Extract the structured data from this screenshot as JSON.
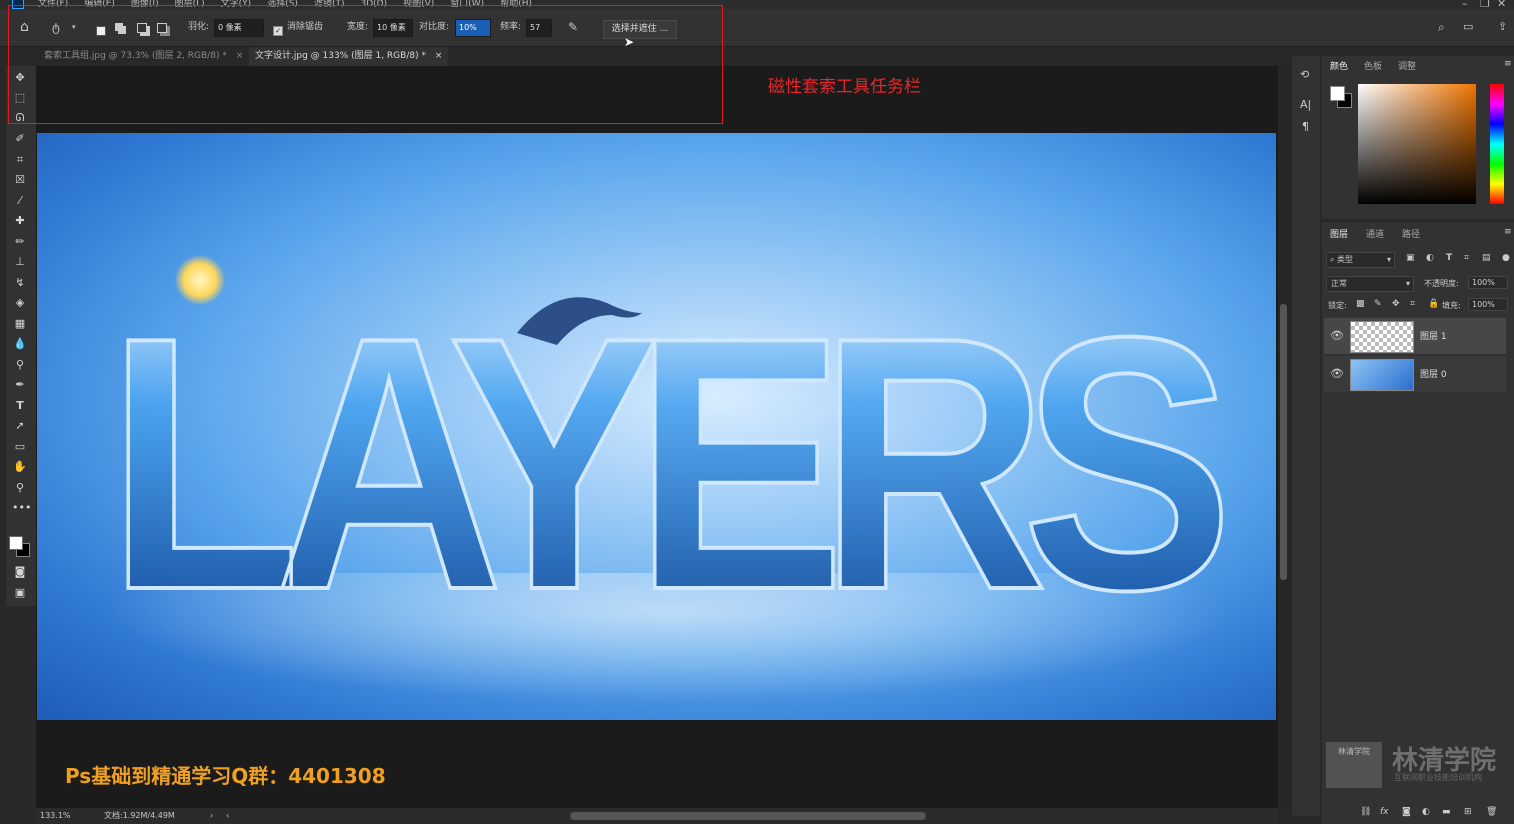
{
  "menubar": {
    "items": [
      "文件(F)",
      "编辑(E)",
      "图像(I)",
      "图层(L)",
      "文字(Y)",
      "选择(S)",
      "滤镜(T)",
      "3D(D)",
      "视图(V)",
      "窗口(W)",
      "帮助(H)"
    ]
  },
  "options": {
    "feather_label": "羽化:",
    "feather_value": "0 像素",
    "antialias_label": "消除锯齿",
    "width_label": "宽度:",
    "width_value": "10 像素",
    "contrast_label": "对比度:",
    "contrast_value": "10%",
    "frequency_label": "频率:",
    "frequency_value": "57",
    "select_mask_label": "选择并遮住 ..."
  },
  "tabs": [
    {
      "label": "套索工具组.jpg @ 73.3% (图层 2, RGB/8) *",
      "close": "×"
    },
    {
      "label": "文字设计.jpg @ 133% (图层 1, RGB/8) *",
      "close": "×"
    }
  ],
  "annotation": "磁性套索工具任务栏",
  "qq_group_text": "Ps基础到精通学习Q群：4401308",
  "document_image_text": "LAYERS",
  "status": {
    "zoom": "133.1%",
    "doc_info": "文档:1.92M/4.49M"
  },
  "color_panel": {
    "tabs": [
      "颜色",
      "色板",
      "调整"
    ]
  },
  "layers_panel": {
    "tabs": [
      "图层",
      "通道",
      "路径"
    ],
    "filter_kind": "类型",
    "blend_mode": "正常",
    "opacity_label": "不透明度:",
    "opacity_value": "100%",
    "lock_label": "锁定:",
    "fill_label": "填充:",
    "fill_value": "100%",
    "layers": [
      {
        "name": "图层 1",
        "selected": true
      },
      {
        "name": "图层 0",
        "selected": false
      }
    ]
  },
  "watermark": {
    "title": "林清学院",
    "subtitle": "互联网职业技能培训机构",
    "badge": "林清学院"
  },
  "colors": {
    "accent_red": "#e01c1c",
    "qq_text": "#f0a020",
    "doc_blue": "#3b8ae0"
  }
}
